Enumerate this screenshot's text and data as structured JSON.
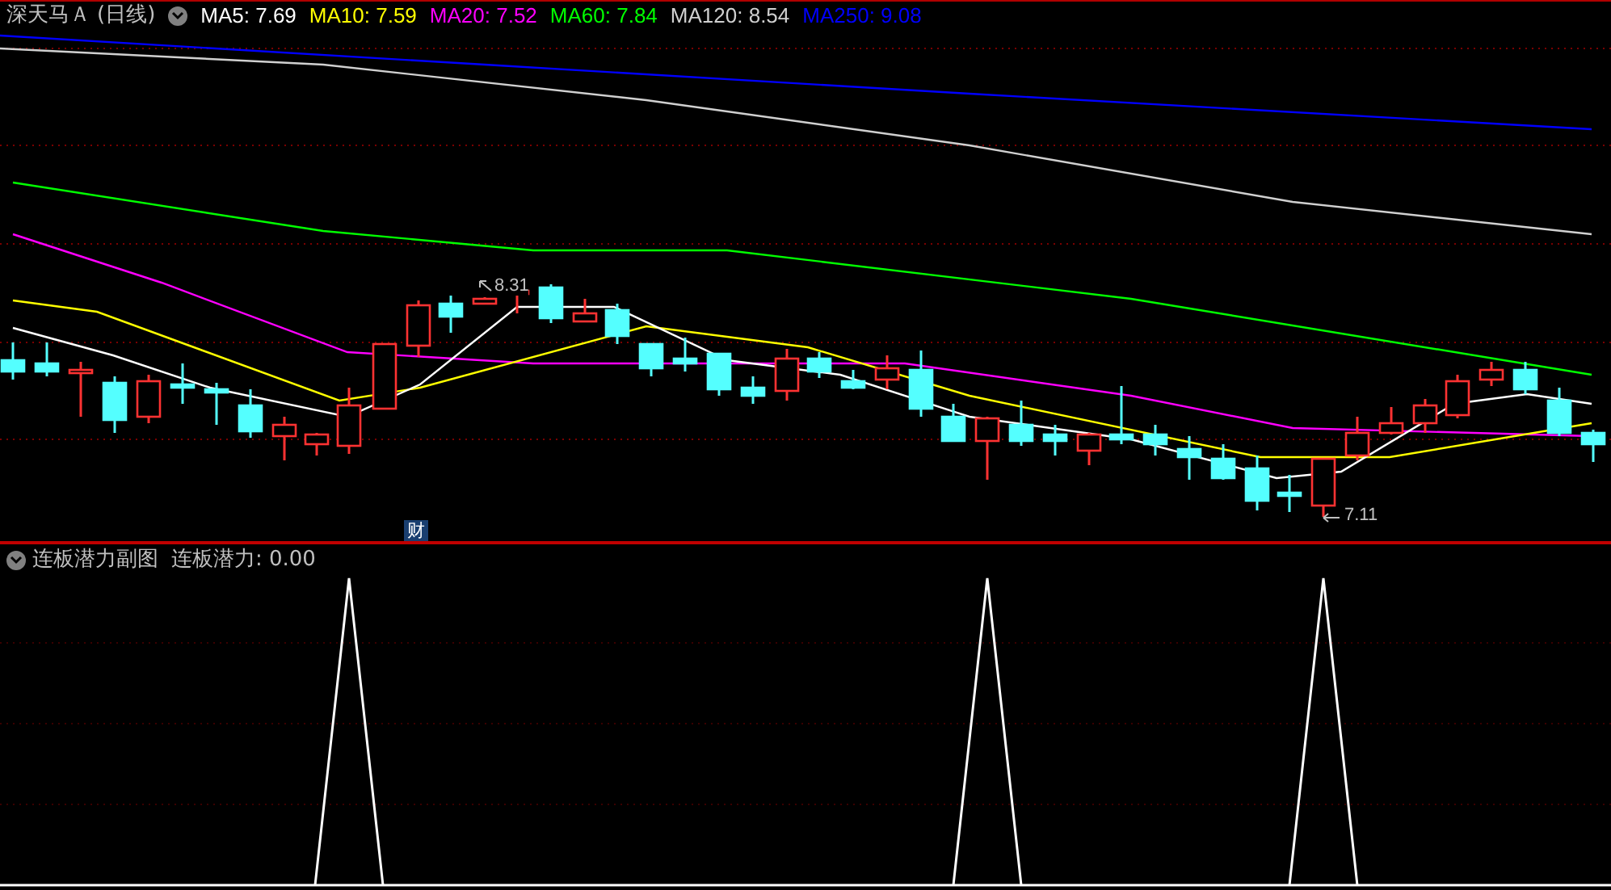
{
  "main_chart": {
    "title": "深天马Ａ",
    "period": "(日线)",
    "indicators": [
      {
        "label": "MA5: 7.69",
        "color": "#ffffff"
      },
      {
        "label": "MA10: 7.59",
        "color": "#ffff00"
      },
      {
        "label": "MA20: 7.52",
        "color": "#ff00ff"
      },
      {
        "label": "MA60: 7.84",
        "color": "#00ff00"
      },
      {
        "label": "MA120: 8.54",
        "color": "#d0d0d0"
      },
      {
        "label": "MA250: 9.08",
        "color": "#0000ff"
      }
    ],
    "high_label": "8.31",
    "low_label": "7.11",
    "badge": "财"
  },
  "sub_chart": {
    "title": "连板潜力副图",
    "indicator": "连板潜力: 0.00"
  }
}
